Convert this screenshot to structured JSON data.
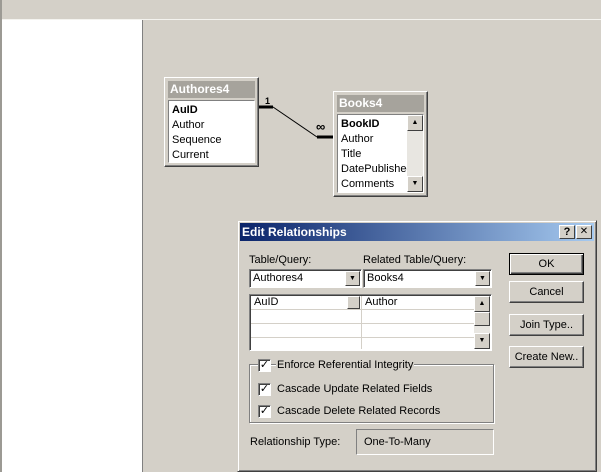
{
  "tables": [
    {
      "id": "authores",
      "title": "Authores4",
      "fields": [
        "AuID",
        "Author",
        "Sequence",
        "Current"
      ],
      "key_field": "AuID"
    },
    {
      "id": "books",
      "title": "Books4",
      "fields": [
        "BookID",
        "Author",
        "Title",
        "DatePublishec",
        "Comments"
      ],
      "key_field": "BookID"
    }
  ],
  "relationship_line": {
    "one_label": "1",
    "many_label": "∞"
  },
  "dialog": {
    "title": "Edit Relationships",
    "help_button": "?",
    "close_button": "✕",
    "table_query_label": "Table/Query:",
    "related_table_label": "Related Table/Query:",
    "table_query_value": "Authores4",
    "related_table_value": "Books4",
    "field_rows": [
      {
        "left": "AuID",
        "right": "Author"
      }
    ],
    "ok_button": "OK",
    "cancel_button": "Cancel",
    "join_type_button": "Join Type..",
    "create_new_button": "Create New..",
    "options": [
      {
        "label": "Enforce Referential Integrity",
        "checked": true
      },
      {
        "label": "Cascade Update Related Fields",
        "checked": true
      },
      {
        "label": "Cascade Delete Related Records",
        "checked": true
      }
    ],
    "relationship_type_label": "Relationship Type:",
    "relationship_type_value": "One-To-Many"
  },
  "icons": {
    "scroll_up": "arrow-up-icon",
    "scroll_down": "arrow-down-icon",
    "dropdown": "chevron-down-icon"
  }
}
